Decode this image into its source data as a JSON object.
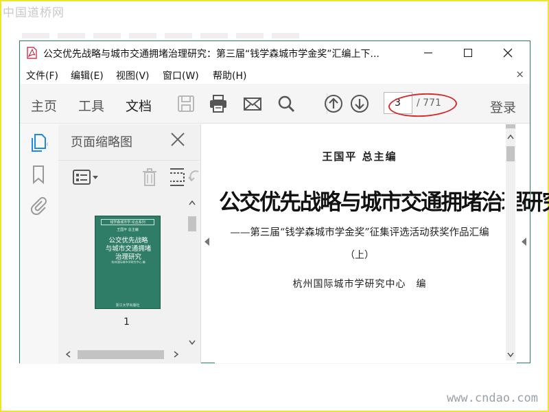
{
  "watermark": {
    "top_left": "中国道桥网",
    "bottom_right": "www.cndao.com"
  },
  "window": {
    "title": "公交优先战略与城市交通拥堵治理研究：第三届“钱学森城市学金奖”汇编上下...",
    "controls": {
      "minimize": "—",
      "maximize": "☐",
      "close": "✕"
    }
  },
  "menu": {
    "items": [
      "文件(F)",
      "编辑(E)",
      "视图(V)",
      "窗口(W)",
      "帮助(H)"
    ],
    "close": "×"
  },
  "toolbar": {
    "tabs": [
      "主页",
      "工具",
      "文档"
    ],
    "active_tab": "文档",
    "icons": [
      "save-icon",
      "print-icon",
      "mail-icon",
      "search-icon",
      "page-up-icon",
      "page-down-icon"
    ],
    "current_page": "3",
    "total_pages": "/ 771",
    "login": "登录"
  },
  "rail": {
    "icons": [
      "pages-icon",
      "bookmark-icon",
      "attachment-icon"
    ]
  },
  "thumbnails": {
    "title": "页面缩略图",
    "page_label": "1",
    "cover": {
      "band": "钱学森城市学·论丛系列",
      "editor": "王国平 总主编",
      "title_lines": [
        "公交优先战略",
        "与城市交通拥堵",
        "治理研究"
      ],
      "publisher": "杭州国际城市学研究中心 编",
      "bottom": "浙江大学出版社"
    }
  },
  "document": {
    "editor": "王国平 总主编",
    "title": "公交优先战略与城市交通拥堵治理研究",
    "subtitle": "——第三届“钱学森城市学金奖”征集评选活动获奖作品汇编",
    "volume": "（上）",
    "organization": "杭州国际城市学研究中心　编"
  },
  "colors": {
    "accent_border": "#2e7d5b",
    "highlight": "#d32b2b",
    "cover_green": "#2f7d66",
    "frame": "#f2e22a"
  }
}
